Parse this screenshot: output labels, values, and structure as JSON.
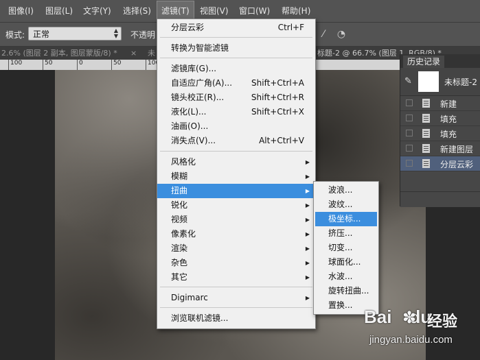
{
  "menubar": {
    "items": [
      "图像(I)",
      "图层(L)",
      "文字(Y)",
      "选择(S)",
      "滤镜(T)",
      "视图(V)",
      "窗口(W)",
      "帮助(H)"
    ],
    "active": "滤镜(T)"
  },
  "options": {
    "mode_label": "模式:",
    "mode_value": "正常",
    "opacity_label": "不透明"
  },
  "tabs": {
    "tab1": "2.6% (图层 2 副本, 图层蒙版/8) *",
    "tab1_close": "×",
    "tab2": "未",
    "tab3": "标题-2 @ 66.7% (图层 1, RGB/8) *"
  },
  "ruler": {
    "ticks": [
      "100",
      "50",
      "0",
      "50",
      "100"
    ]
  },
  "filter_menu": {
    "items": [
      {
        "label": "分层云彩",
        "shortcut": "Ctrl+F"
      },
      {
        "label": "转换为智能滤镜",
        "shortcut": ""
      },
      {
        "label": "滤镜库(G)...",
        "shortcut": ""
      },
      {
        "label": "自适应广角(A)...",
        "shortcut": "Shift+Ctrl+A"
      },
      {
        "label": "镜头校正(R)...",
        "shortcut": "Shift+Ctrl+R"
      },
      {
        "label": "液化(L)...",
        "shortcut": "Shift+Ctrl+X"
      },
      {
        "label": "油画(O)...",
        "shortcut": ""
      },
      {
        "label": "消失点(V)...",
        "shortcut": "Alt+Ctrl+V"
      },
      {
        "label": "风格化",
        "shortcut": ""
      },
      {
        "label": "模糊",
        "shortcut": ""
      },
      {
        "label": "扭曲",
        "shortcut": ""
      },
      {
        "label": "锐化",
        "shortcut": ""
      },
      {
        "label": "视频",
        "shortcut": ""
      },
      {
        "label": "像素化",
        "shortcut": ""
      },
      {
        "label": "渲染",
        "shortcut": ""
      },
      {
        "label": "杂色",
        "shortcut": ""
      },
      {
        "label": "其它",
        "shortcut": ""
      },
      {
        "label": "Digimarc",
        "shortcut": ""
      },
      {
        "label": "浏览联机滤镜...",
        "shortcut": ""
      }
    ],
    "highlighted": "扭曲"
  },
  "distort_menu": {
    "items": [
      "波浪...",
      "波纹...",
      "极坐标...",
      "挤压...",
      "切变...",
      "球面化...",
      "水波...",
      "旋转扭曲...",
      "置换..."
    ],
    "highlighted": "极坐标..."
  },
  "history": {
    "title": "历史记录",
    "snapshot": "未标题-2",
    "items": [
      "新建",
      "填充",
      "填充",
      "新建图层",
      "分层云彩"
    ],
    "selected": "分层云彩"
  },
  "watermark": {
    "logo": "Bai",
    "logo_suffix": "du",
    "brand": "经验",
    "url": "jingyan.baidu.com"
  },
  "colors": {
    "menu_highlight": "#3b8ede",
    "history_selected": "#50607c"
  },
  "icons": {
    "submenu_arrow": "triangle-right-icon",
    "snapshot": "brush-icon",
    "history_step": "document-icon"
  }
}
